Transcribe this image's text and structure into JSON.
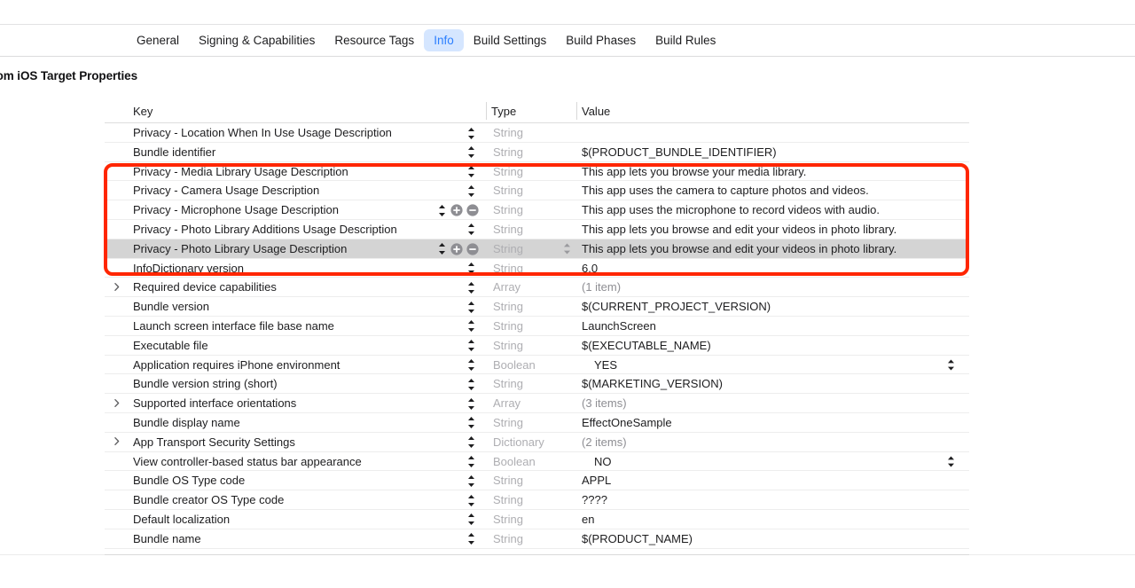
{
  "tabs": [
    {
      "label": "General",
      "active": false
    },
    {
      "label": "Signing & Capabilities",
      "active": false
    },
    {
      "label": "Resource Tags",
      "active": false
    },
    {
      "label": "Info",
      "active": true
    },
    {
      "label": "Build Settings",
      "active": false
    },
    {
      "label": "Build Phases",
      "active": false
    },
    {
      "label": "Build Rules",
      "active": false
    }
  ],
  "section": {
    "heading": "Custom iOS Target Properties",
    "visible_fragment": "ties"
  },
  "table": {
    "columns": {
      "key": "Key",
      "type": "Type",
      "value": "Value"
    },
    "rows": [
      {
        "key": "Privacy - Location When In Use Usage Description",
        "type": "String",
        "value": "",
        "stepper": true,
        "addremove": false,
        "disclosure": false,
        "selected": false,
        "value_dim": false,
        "type_popup": false,
        "bool_popup": false
      },
      {
        "key": "Bundle identifier",
        "type": "String",
        "value": "$(PRODUCT_BUNDLE_IDENTIFIER)",
        "stepper": true,
        "addremove": false,
        "disclosure": false,
        "selected": false,
        "value_dim": false,
        "type_popup": false,
        "bool_popup": false
      },
      {
        "key": "Privacy - Media Library Usage Description",
        "type": "String",
        "value": "This app lets you browse your media library.",
        "stepper": true,
        "addremove": false,
        "disclosure": false,
        "selected": false,
        "value_dim": false,
        "type_popup": false,
        "bool_popup": false
      },
      {
        "key": "Privacy - Camera Usage Description",
        "type": "String",
        "value": "This app uses the camera to capture photos and videos.",
        "stepper": true,
        "addremove": false,
        "disclosure": false,
        "selected": false,
        "value_dim": false,
        "type_popup": false,
        "bool_popup": false
      },
      {
        "key": "Privacy - Microphone Usage Description",
        "type": "String",
        "value": "This app uses the microphone to record videos with audio.",
        "stepper": true,
        "addremove": true,
        "disclosure": false,
        "selected": false,
        "value_dim": false,
        "type_popup": false,
        "bool_popup": false
      },
      {
        "key": "Privacy - Photo Library Additions Usage Description",
        "type": "String",
        "value": "This app lets you browse and edit your videos in photo library.",
        "stepper": true,
        "addremove": false,
        "disclosure": false,
        "selected": false,
        "value_dim": false,
        "type_popup": false,
        "bool_popup": false
      },
      {
        "key": "Privacy - Photo Library Usage Description",
        "type": "String",
        "value": "This app lets you browse and edit your videos in photo library.",
        "stepper": true,
        "addremove": true,
        "disclosure": false,
        "selected": true,
        "value_dim": false,
        "type_popup": true,
        "bool_popup": false
      },
      {
        "key": "InfoDictionary version",
        "type": "String",
        "value": "6.0",
        "stepper": true,
        "addremove": false,
        "disclosure": false,
        "selected": false,
        "value_dim": false,
        "type_popup": false,
        "bool_popup": false
      },
      {
        "key": "Required device capabilities",
        "type": "Array",
        "value": "(1 item)",
        "stepper": true,
        "addremove": false,
        "disclosure": true,
        "selected": false,
        "value_dim": true,
        "type_popup": false,
        "bool_popup": false
      },
      {
        "key": "Bundle version",
        "type": "String",
        "value": "$(CURRENT_PROJECT_VERSION)",
        "stepper": true,
        "addremove": false,
        "disclosure": false,
        "selected": false,
        "value_dim": false,
        "type_popup": false,
        "bool_popup": false
      },
      {
        "key": "Launch screen interface file base name",
        "type": "String",
        "value": "LaunchScreen",
        "stepper": true,
        "addremove": false,
        "disclosure": false,
        "selected": false,
        "value_dim": false,
        "type_popup": false,
        "bool_popup": false
      },
      {
        "key": "Executable file",
        "type": "String",
        "value": "$(EXECUTABLE_NAME)",
        "stepper": true,
        "addremove": false,
        "disclosure": false,
        "selected": false,
        "value_dim": false,
        "type_popup": false,
        "bool_popup": false
      },
      {
        "key": "Application requires iPhone environment",
        "type": "Boolean",
        "value": "YES",
        "stepper": true,
        "addremove": false,
        "disclosure": false,
        "selected": false,
        "value_dim": false,
        "type_popup": false,
        "bool_popup": true
      },
      {
        "key": "Bundle version string (short)",
        "type": "String",
        "value": "$(MARKETING_VERSION)",
        "stepper": true,
        "addremove": false,
        "disclosure": false,
        "selected": false,
        "value_dim": false,
        "type_popup": false,
        "bool_popup": false
      },
      {
        "key": "Supported interface orientations",
        "type": "Array",
        "value": "(3 items)",
        "stepper": true,
        "addremove": false,
        "disclosure": true,
        "selected": false,
        "value_dim": true,
        "type_popup": false,
        "bool_popup": false
      },
      {
        "key": "Bundle display name",
        "type": "String",
        "value": "EffectOneSample",
        "stepper": true,
        "addremove": false,
        "disclosure": false,
        "selected": false,
        "value_dim": false,
        "type_popup": false,
        "bool_popup": false
      },
      {
        "key": "App Transport Security Settings",
        "type": "Dictionary",
        "value": "(2 items)",
        "stepper": true,
        "addremove": false,
        "disclosure": true,
        "selected": false,
        "value_dim": true,
        "type_popup": false,
        "bool_popup": false
      },
      {
        "key": "View controller-based status bar appearance",
        "type": "Boolean",
        "value": "NO",
        "stepper": true,
        "addremove": false,
        "disclosure": false,
        "selected": false,
        "value_dim": false,
        "type_popup": false,
        "bool_popup": true
      },
      {
        "key": "Bundle OS Type code",
        "type": "String",
        "value": "APPL",
        "stepper": true,
        "addremove": false,
        "disclosure": false,
        "selected": false,
        "value_dim": false,
        "type_popup": false,
        "bool_popup": false
      },
      {
        "key": "Bundle creator OS Type code",
        "type": "String",
        "value": "????",
        "stepper": true,
        "addremove": false,
        "disclosure": false,
        "selected": false,
        "value_dim": false,
        "type_popup": false,
        "bool_popup": false
      },
      {
        "key": "Default localization",
        "type": "String",
        "value": "en",
        "stepper": true,
        "addremove": false,
        "disclosure": false,
        "selected": false,
        "value_dim": false,
        "type_popup": false,
        "bool_popup": false
      },
      {
        "key": "Bundle name",
        "type": "String",
        "value": "$(PRODUCT_NAME)",
        "stepper": true,
        "addremove": false,
        "disclosure": false,
        "selected": false,
        "value_dim": false,
        "type_popup": false,
        "bool_popup": false
      }
    ]
  },
  "annotation": {
    "color": "#ff2600",
    "highlighted_keys": [
      "Privacy - Media Library Usage Description",
      "Privacy - Camera Usage Description",
      "Privacy - Microphone Usage Description",
      "Privacy - Photo Library Additions Usage Description",
      "Privacy - Photo Library Usage Description"
    ]
  },
  "colors": {
    "accent": "#2b7fff",
    "tab_active_bg": "#d5e6ff",
    "selected_row_bg": "#d4d4d4",
    "type_text": "#aeaeb2",
    "annotation": "#ff2600"
  }
}
